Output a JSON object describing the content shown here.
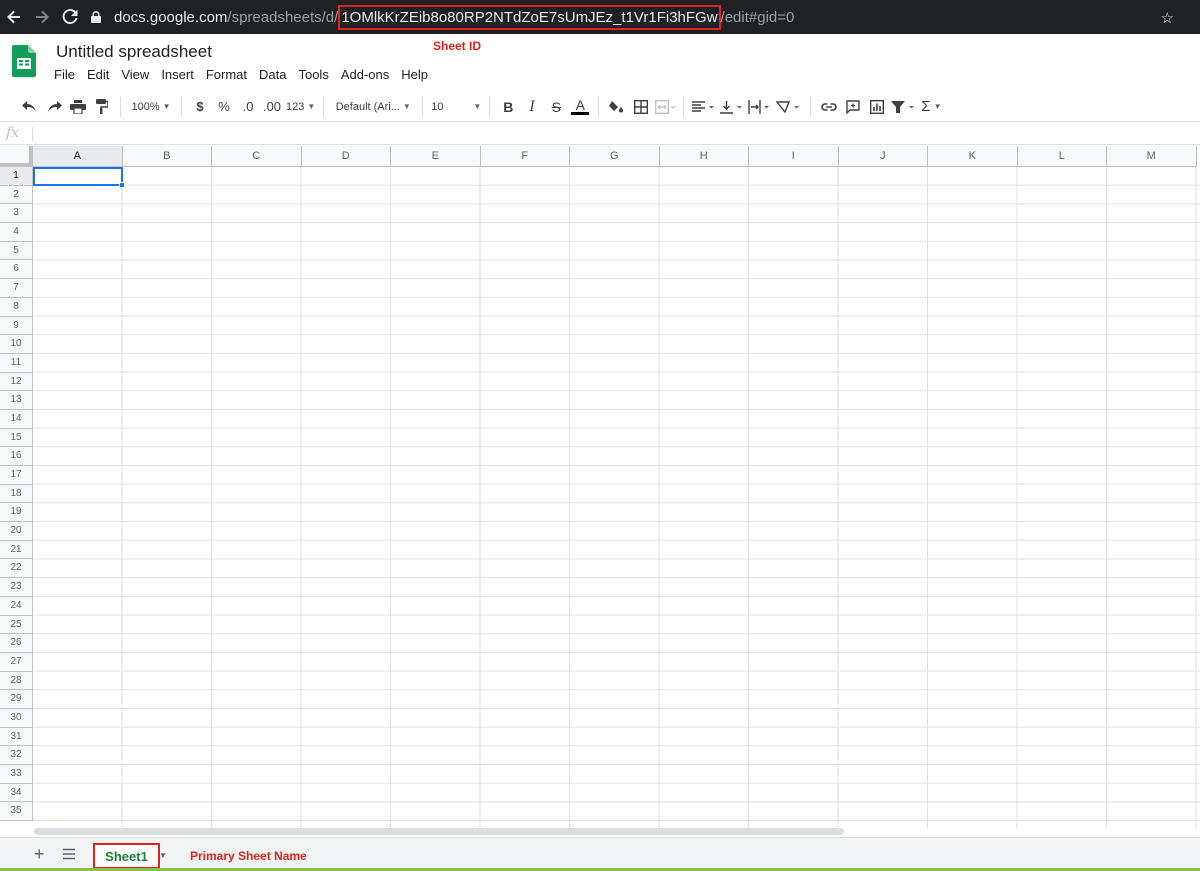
{
  "browser": {
    "url_host": "docs.google.com",
    "url_path": "/spreadsheets/d/",
    "sheet_id": "1OMlkKrZEib8o80RP2NTdZoE7sUmJEz_t1Vr1Fi3hFGw",
    "url_suffix": "/edit#gid=0",
    "icons": [
      "back-icon",
      "forward-icon",
      "reload-icon",
      "lock-icon",
      "star-icon"
    ]
  },
  "annotations": {
    "sheet_id_label": "Sheet ID",
    "sheet_name_label": "Primary Sheet Name",
    "color": "#e0241b"
  },
  "doc": {
    "title": "Untitled spreadsheet",
    "menu": [
      "File",
      "Edit",
      "View",
      "Insert",
      "Format",
      "Data",
      "Tools",
      "Add-ons",
      "Help"
    ]
  },
  "toolbar": {
    "zoom": "100%",
    "currency": "$",
    "percent": "%",
    "decrease_decimal": ".0",
    "increase_decimal": ".00",
    "more_formats": "123",
    "font": "Default (Ari...",
    "font_size": "10",
    "bold": "B",
    "italic": "I",
    "strike": "S",
    "text_color": "A",
    "sum": "Σ"
  },
  "formula_bar": {
    "fx": "fx",
    "value": ""
  },
  "grid": {
    "columns": [
      "A",
      "B",
      "C",
      "D",
      "E",
      "F",
      "G",
      "H",
      "I",
      "J",
      "K",
      "L",
      "M"
    ],
    "rows": [
      "1",
      "2",
      "3",
      "4",
      "5",
      "6",
      "7",
      "8",
      "9",
      "10",
      "11",
      "12",
      "13",
      "14",
      "15",
      "16",
      "17",
      "18",
      "19",
      "20",
      "21",
      "22",
      "23",
      "24",
      "25",
      "26",
      "27",
      "28",
      "29",
      "30",
      "31",
      "32",
      "33",
      "34",
      "35"
    ],
    "active_cell": "A1"
  },
  "sheets": {
    "tabs": [
      {
        "name": "Sheet1",
        "active": true
      }
    ],
    "accent_color": "#188038"
  },
  "colors": {
    "selection": "#1a73e8",
    "sheets_green": "#0f9d58"
  }
}
